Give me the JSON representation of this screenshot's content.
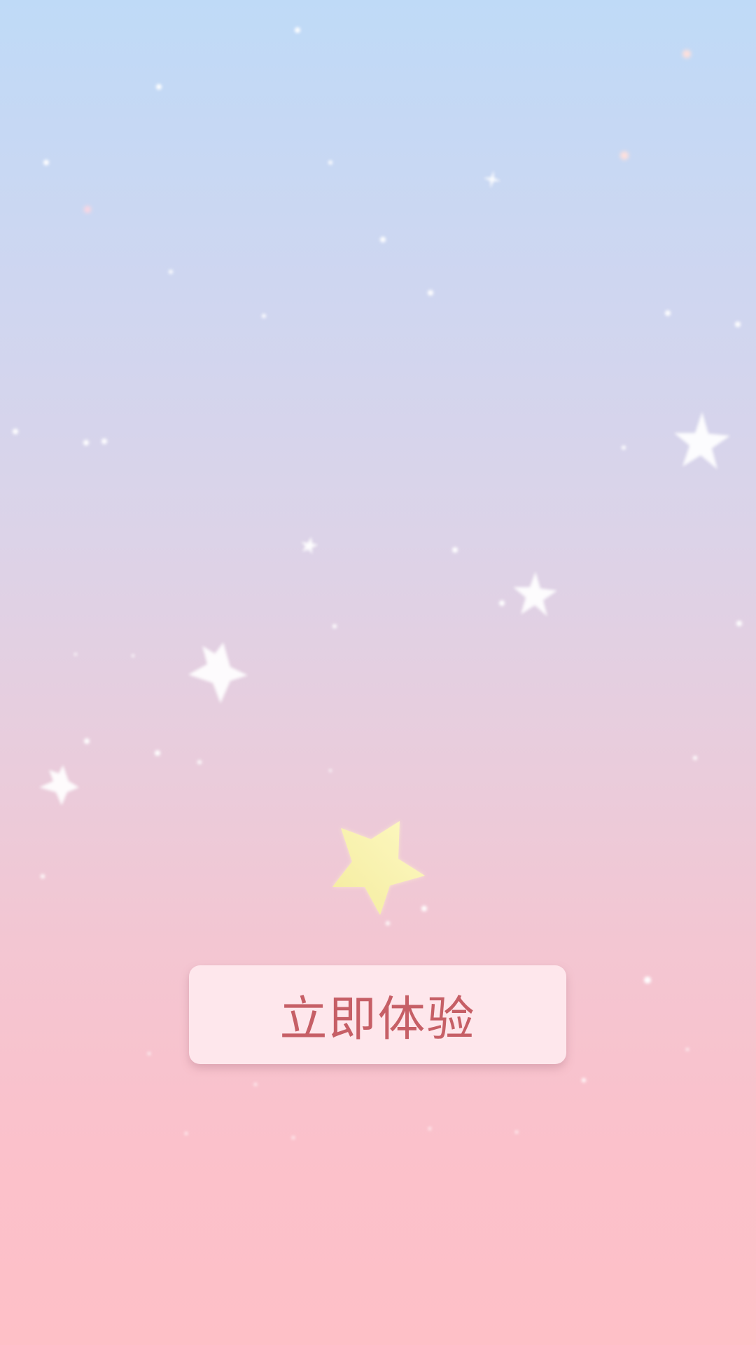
{
  "screen": {
    "background_top": "#bfdaf7",
    "background_bottom": "#fec0c7",
    "star_color": "#ffffff",
    "highlight_star_color": "#fbf4b4"
  },
  "cta": {
    "label": "立即体验",
    "text_color": "#c65f66",
    "fill_color": "#fee7ec"
  }
}
